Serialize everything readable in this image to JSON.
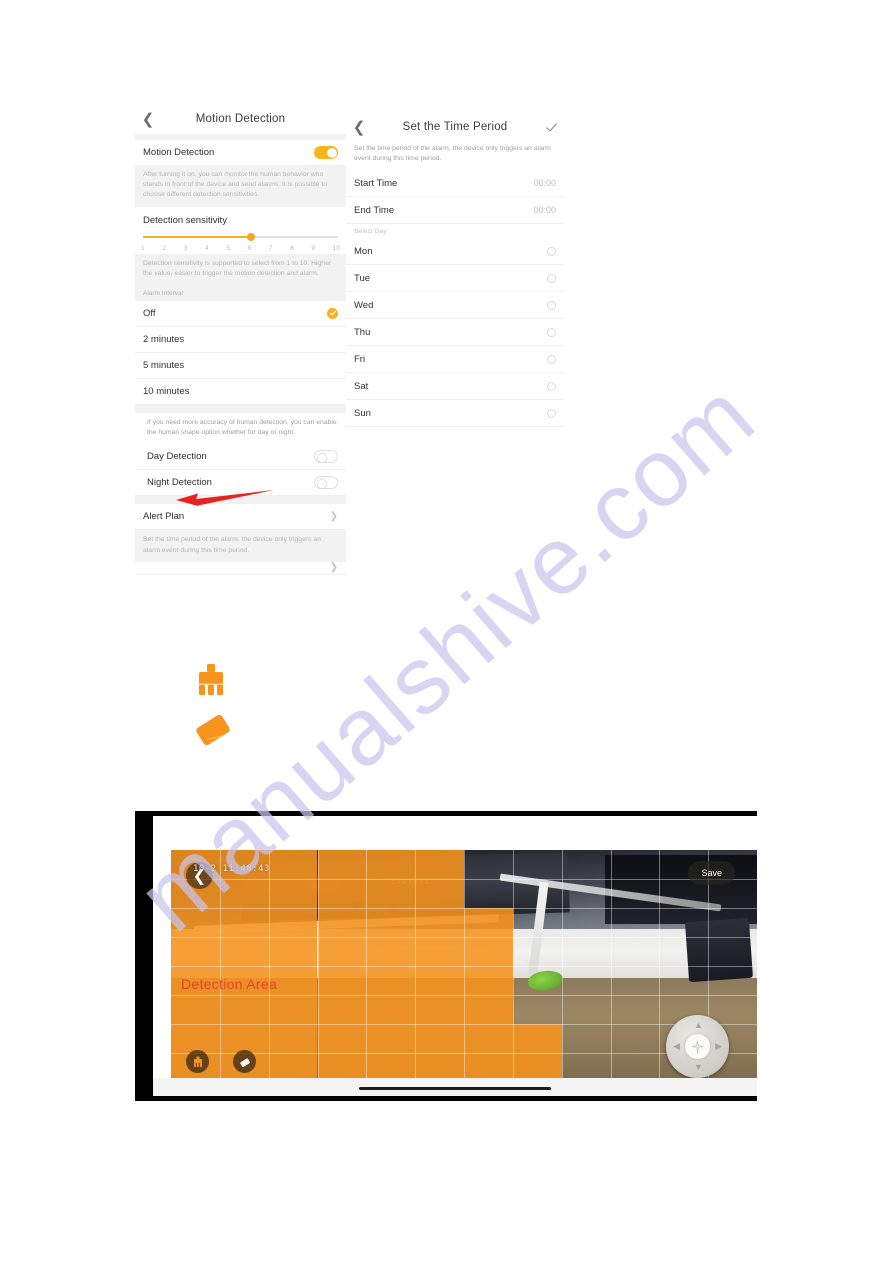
{
  "watermark": {
    "text": "manualshive.com",
    "color": "#c9c6ee"
  },
  "accent": {
    "orange": "#f5b31b",
    "mask": "#f7931e",
    "red": "#e8422c"
  },
  "motion_detection_screen": {
    "nav": {
      "back_icon": "chevron-left-icon",
      "title": "Motion Detection"
    },
    "motion_detection": {
      "label": "Motion Detection",
      "toggle_state": "on",
      "description": "After turning it on, you can monitor the human behavior who stands in front of the device and send alarms. It is possible to choose different detection sensitivities."
    },
    "sensitivity": {
      "heading": "Detection sensitivity",
      "value": 6,
      "min": 1,
      "max": 10,
      "ticks": [
        "1",
        "2",
        "3",
        "4",
        "5",
        "6",
        "7",
        "8",
        "9",
        "10"
      ],
      "description": "Detection sensitivity is supported to select from 1 to 10. Higher the value, easier to trigger the motion detection and alarm."
    },
    "alarm_interval": {
      "group_label": "Alarm Interval",
      "options": [
        {
          "label": "Off",
          "selected": true
        },
        {
          "label": "2 minutes",
          "selected": false
        },
        {
          "label": "5 minutes",
          "selected": false
        },
        {
          "label": "10 minutes",
          "selected": false
        }
      ]
    },
    "human_shape": {
      "description": "If you need more accuracy of human detection, you can enable the human shape option whether for day or night.",
      "rows": [
        {
          "label": "Day Detection",
          "toggle_state": "off"
        },
        {
          "label": "Night Detection",
          "toggle_state": "off"
        }
      ]
    },
    "alert_plan": {
      "label": "Alert Plan",
      "chevron_icon": "chevron-right-icon",
      "description": "Set the time period of the alarm, the device only triggers an alarm event during this time period."
    },
    "annotation": {
      "type": "red-arrow",
      "points_to": "Alert Plan"
    }
  },
  "time_period_screen": {
    "nav": {
      "back_icon": "chevron-left-icon",
      "title": "Set the Time Period",
      "confirm_icon": "check-icon"
    },
    "description": "Set the time period of the alarm, the device only triggers an alarm event during this time period.",
    "times": [
      {
        "label": "Start Time",
        "value": "00:00"
      },
      {
        "label": "End Time",
        "value": "00:00"
      }
    ],
    "select_day_label": "Select Day",
    "days": [
      {
        "label": "Mon",
        "selected": false
      },
      {
        "label": "Tue",
        "selected": false
      },
      {
        "label": "Wed",
        "selected": false
      },
      {
        "label": "Thu",
        "selected": false
      },
      {
        "label": "Fri",
        "selected": false
      },
      {
        "label": "Sat",
        "selected": false
      },
      {
        "label": "Sun",
        "selected": false
      }
    ]
  },
  "tool_icons": [
    {
      "name": "brush-icon",
      "color": "#f7941e"
    },
    {
      "name": "eraser-icon",
      "color": "#f7941e"
    }
  ],
  "detection_area_screen": {
    "back_icon": "chevron-left-icon",
    "save_label": "Save",
    "timestamp": "10-2  11:48:43",
    "detection_area_label": "Detection Area",
    "tools": [
      {
        "name": "brush-icon",
        "active": true
      },
      {
        "name": "eraser-icon",
        "active": false
      }
    ],
    "joystick": {
      "up_icon": "chevron-up-icon",
      "down_icon": "chevron-down-icon",
      "left_icon": "chevron-left-icon",
      "right_icon": "chevron-right-icon",
      "center_icon": "focus-icon"
    }
  }
}
